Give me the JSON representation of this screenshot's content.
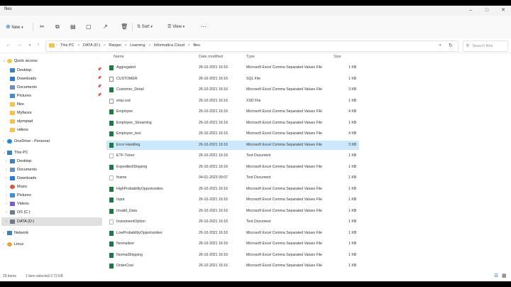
{
  "window": {
    "title": "files"
  },
  "toolbar": {
    "new_label": "New",
    "sort_label": "Sort",
    "view_label": "View"
  },
  "address": {
    "crumbs": [
      "This PC",
      ">",
      "DATA (D:)",
      ">",
      "Ranjan",
      ">",
      "Learning",
      ">",
      "Informatica Cloud",
      ">",
      "files"
    ]
  },
  "search": {
    "placeholder": "Search files"
  },
  "sidebar": {
    "items": [
      {
        "label": "Quick access",
        "icon": "star-icon",
        "color": "#f2c744"
      },
      {
        "label": "Desktop",
        "icon": "desktop-icon",
        "color": "#3b82c4"
      },
      {
        "label": "Downloads",
        "icon": "download-icon",
        "color": "#2b7bd8"
      },
      {
        "label": "Documents",
        "icon": "documents-icon",
        "color": "#6d8fb8"
      },
      {
        "label": "Pictures",
        "icon": "pictures-icon",
        "color": "#3f8ed8"
      },
      {
        "label": "files",
        "icon": "folder-icon",
        "color": "#f4c34d"
      },
      {
        "label": "Myfaces",
        "icon": "folder-icon",
        "color": "#f4c34d"
      },
      {
        "label": "olympiad",
        "icon": "folder-icon",
        "color": "#f4c34d"
      },
      {
        "label": "videos",
        "icon": "folder-icon",
        "color": "#f4c34d"
      },
      {
        "label": "OneDrive - Personal",
        "icon": "cloud-icon",
        "color": "#1f8ae0"
      },
      {
        "label": "This PC",
        "icon": "computer-icon",
        "color": "#3b82c4"
      },
      {
        "label": "Desktop",
        "icon": "desktop-icon",
        "color": "#3b82c4"
      },
      {
        "label": "Documents",
        "icon": "documents-icon",
        "color": "#6d8fb8"
      },
      {
        "label": "Downloads",
        "icon": "download-icon",
        "color": "#2b7bd8"
      },
      {
        "label": "Music",
        "icon": "music-icon",
        "color": "#e0533b"
      },
      {
        "label": "Pictures",
        "icon": "pictures-icon",
        "color": "#3f8ed8"
      },
      {
        "label": "Videos",
        "icon": "videos-icon",
        "color": "#7a5bd0"
      },
      {
        "label": "OS (C:)",
        "icon": "drive-icon",
        "color": "#6b7c8a"
      },
      {
        "label": "DATA (D:)",
        "icon": "drive-icon",
        "color": "#6b7c8a"
      },
      {
        "label": "Network",
        "icon": "network-icon",
        "color": "#3b82c4"
      },
      {
        "label": "Linux",
        "icon": "linux-icon",
        "color": "#e8a33a"
      }
    ]
  },
  "columns": {
    "name": "Name",
    "date": "Date modified",
    "type": "Type",
    "size": "Size"
  },
  "files": [
    {
      "name": "Aggregated",
      "date": "26-10-2021 16:16",
      "type": "Microsoft Excel Comma Separated Values File",
      "size": "1 KB",
      "kind": "csv"
    },
    {
      "name": "CUSTOMER",
      "date": "26-10-2021 16:16",
      "type": "SQL File",
      "size": "1 KB",
      "kind": "sql"
    },
    {
      "name": "Customer_Detail",
      "date": "26-10-2021 16:16",
      "type": "Microsoft Excel Comma Separated Values File",
      "size": "3 KB",
      "kind": "csv"
    },
    {
      "name": "emp.xsd",
      "date": "26-10-2021 16:16",
      "type": "XSD File",
      "size": "1 KB",
      "kind": "xsd"
    },
    {
      "name": "Employee",
      "date": "26-10-2021 16:16",
      "type": "Microsoft Excel Comma Separated Values File",
      "size": "4 KB",
      "kind": "csv"
    },
    {
      "name": "Employee_Streaming",
      "date": "26-10-2021 16:16",
      "type": "Microsoft Excel Comma Separated Values File",
      "size": "1 KB",
      "kind": "csv"
    },
    {
      "name": "Employee_test",
      "date": "26-10-2021 16:16",
      "type": "Microsoft Excel Comma Separated Values File",
      "size": "4 KB",
      "kind": "csv"
    },
    {
      "name": "Error Handling",
      "date": "26-10-2021 16:16",
      "type": "Microsoft Excel Comma Separated Values File",
      "size": "3 KB",
      "kind": "csv",
      "selected": true
    },
    {
      "name": "ETF-Ticker",
      "date": "26-10-2021 16:16",
      "type": "Text Document",
      "size": "1 KB",
      "kind": "txt"
    },
    {
      "name": "ExpeditedShipping",
      "date": "26-10-2021 16:16",
      "type": "Microsoft Excel Comma Separated Values File",
      "size": "1 KB",
      "kind": "csv"
    },
    {
      "name": "fname",
      "date": "04-01-2023 09:07",
      "type": "Text Document",
      "size": "1 KB",
      "kind": "txt"
    },
    {
      "name": "HighProbabilityOpportunities",
      "date": "26-10-2021 16:16",
      "type": "Microsoft Excel Comma Separated Values File",
      "size": "1 KB",
      "kind": "csv"
    },
    {
      "name": "Input",
      "date": "26-10-2021 16:16",
      "type": "Microsoft Excel Comma Separated Values File",
      "size": "1 KB",
      "kind": "csv"
    },
    {
      "name": "Invalid_Data",
      "date": "26-10-2021 16:16",
      "type": "Microsoft Excel Comma Separated Values File",
      "size": "1 KB",
      "kind": "csv"
    },
    {
      "name": "InvestmentOption",
      "date": "26-10-2021 16:16",
      "type": "Text Document",
      "size": "1 KB",
      "kind": "txt"
    },
    {
      "name": "LowProbabilityOpportunities",
      "date": "26-10-2021 16:16",
      "type": "Microsoft Excel Comma Separated Values File",
      "size": "1 KB",
      "kind": "csv"
    },
    {
      "name": "Normalizer",
      "date": "26-10-2021 16:16",
      "type": "Microsoft Excel Comma Separated Values File",
      "size": "1 KB",
      "kind": "csv"
    },
    {
      "name": "NormalShipping",
      "date": "26-10-2021 16:16",
      "type": "Microsoft Excel Comma Separated Values File",
      "size": "1 KB",
      "kind": "csv"
    },
    {
      "name": "OrderCost",
      "date": "26-10-2021 16:16",
      "type": "Microsoft Excel Comma Separated Values File",
      "size": "1 KB",
      "kind": "csv"
    }
  ],
  "status": {
    "items": "29 items",
    "selected": "1 item selected  2.72 KB"
  }
}
